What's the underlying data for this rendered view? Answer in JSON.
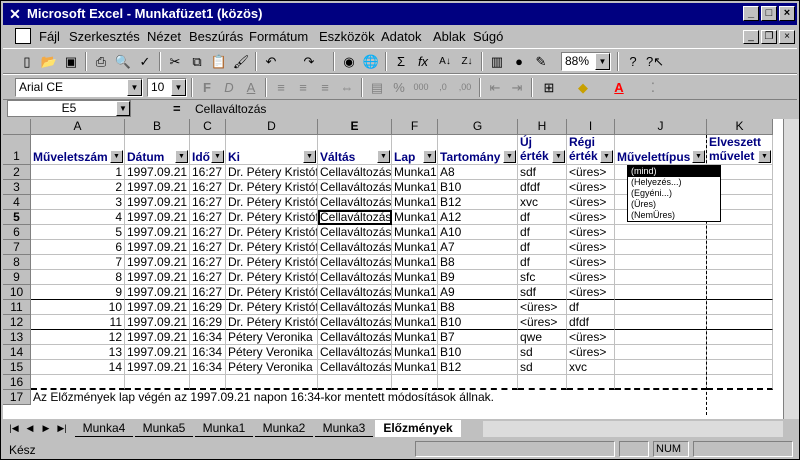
{
  "window": {
    "title": "Microsoft Excel - Munkafüzet1  (közös)",
    "controls": [
      "_",
      "□",
      "×"
    ]
  },
  "menu": [
    "Fájl",
    "Szerkesztés",
    "Nézet",
    "Beszúrás",
    "Formátum",
    "Eszközök",
    "Adatok",
    "Ablak",
    "Súgó"
  ],
  "toolbar": {
    "zoom": "88%",
    "font_name": "Arial CE",
    "font_size": "10",
    "bold": "F",
    "italic": "D",
    "underline": "A",
    "sum": "Σ",
    "fx": "fx",
    "sort_asc": "A↓",
    "sort_desc": "Z↓",
    "percent": "%",
    "thousands": "000",
    "dec_inc": ",0",
    "dec_dec": ",00",
    "font_color": "A",
    "help": "?"
  },
  "formula_bar": {
    "name_box": "E5",
    "equals": "=",
    "value": "Cellaváltozás"
  },
  "columns": [
    "A",
    "B",
    "C",
    "D",
    "E",
    "F",
    "G",
    "H",
    "I",
    "J",
    "K"
  ],
  "header_row": {
    "A": "Műveletszám",
    "B": "Dátum",
    "C": "Idő",
    "D": "Ki",
    "E": "Váltás",
    "F": "Lap",
    "G": "Tartomány",
    "H1": "Új",
    "H2": "érték",
    "I1": "Régi",
    "I2": "érték",
    "J": "Művelettípus",
    "K1": "Elveszett",
    "K2": "művelet"
  },
  "rows": [
    {
      "n": "2",
      "a": "1",
      "b": "1997.09.21",
      "c": "16:27",
      "d": "Dr. Pétery Kristóf",
      "e": "Cellaváltozás",
      "f": "Munka1",
      "g": "A8",
      "h": "sdf",
      "i": "<üres>"
    },
    {
      "n": "3",
      "a": "2",
      "b": "1997.09.21",
      "c": "16:27",
      "d": "Dr. Pétery Kristóf",
      "e": "Cellaváltozás",
      "f": "Munka1",
      "g": "B10",
      "h": "dfdf",
      "i": "<üres>"
    },
    {
      "n": "4",
      "a": "3",
      "b": "1997.09.21",
      "c": "16:27",
      "d": "Dr. Pétery Kristóf",
      "e": "Cellaváltozás",
      "f": "Munka1",
      "g": "B12",
      "h": "xvc",
      "i": "<üres>"
    },
    {
      "n": "5",
      "a": "4",
      "b": "1997.09.21",
      "c": "16:27",
      "d": "Dr. Pétery Kristóf",
      "e": "Cellaváltozás",
      "f": "Munka1",
      "g": "A12",
      "h": "df",
      "i": "<üres>"
    },
    {
      "n": "6",
      "a": "5",
      "b": "1997.09.21",
      "c": "16:27",
      "d": "Dr. Pétery Kristóf",
      "e": "Cellaváltozás",
      "f": "Munka1",
      "g": "A10",
      "h": "df",
      "i": "<üres>"
    },
    {
      "n": "7",
      "a": "6",
      "b": "1997.09.21",
      "c": "16:27",
      "d": "Dr. Pétery Kristóf",
      "e": "Cellaváltozás",
      "f": "Munka1",
      "g": "A7",
      "h": "df",
      "i": "<üres>"
    },
    {
      "n": "8",
      "a": "7",
      "b": "1997.09.21",
      "c": "16:27",
      "d": "Dr. Pétery Kristóf",
      "e": "Cellaváltozás",
      "f": "Munka1",
      "g": "B8",
      "h": "df",
      "i": "<üres>"
    },
    {
      "n": "9",
      "a": "8",
      "b": "1997.09.21",
      "c": "16:27",
      "d": "Dr. Pétery Kristóf",
      "e": "Cellaváltozás",
      "f": "Munka1",
      "g": "B9",
      "h": "sfc",
      "i": "<üres>"
    },
    {
      "n": "10",
      "a": "9",
      "b": "1997.09.21",
      "c": "16:27",
      "d": "Dr. Pétery Kristóf",
      "e": "Cellaváltozás",
      "f": "Munka1",
      "g": "A9",
      "h": "sdf",
      "i": "<üres>"
    },
    {
      "n": "11",
      "a": "10",
      "b": "1997.09.21",
      "c": "16:29",
      "d": "Dr. Pétery Kristóf",
      "e": "Cellaváltozás",
      "f": "Munka1",
      "g": "B8",
      "h": "<üres>",
      "i": "df"
    },
    {
      "n": "12",
      "a": "11",
      "b": "1997.09.21",
      "c": "16:29",
      "d": "Dr. Pétery Kristóf",
      "e": "Cellaváltozás",
      "f": "Munka1",
      "g": "B10",
      "h": "<üres>",
      "i": "dfdf"
    },
    {
      "n": "13",
      "a": "12",
      "b": "1997.09.21",
      "c": "16:34",
      "d": "Pétery Veronika",
      "e": "Cellaváltozás",
      "f": "Munka1",
      "g": "B7",
      "h": "qwe",
      "i": "<üres>"
    },
    {
      "n": "14",
      "a": "13",
      "b": "1997.09.21",
      "c": "16:34",
      "d": "Pétery Veronika",
      "e": "Cellaváltozás",
      "f": "Munka1",
      "g": "B10",
      "h": "sd",
      "i": "<üres>"
    },
    {
      "n": "15",
      "a": "14",
      "b": "1997.09.21",
      "c": "16:34",
      "d": "Pétery Veronika",
      "e": "Cellaváltozás",
      "f": "Munka1",
      "g": "B12",
      "h": "sd",
      "i": "xvc"
    }
  ],
  "row16": "16",
  "row17": {
    "n": "17",
    "text": "Az Előzmények lap végén az 1997.09.21 napon 16:34-kor mentett módosítások állnak."
  },
  "row1_label": "1",
  "filter_dropdown": [
    "(mind)",
    "(Helyezés...)",
    "(Egyéni...)",
    "(Üres)",
    "(NemÜres)"
  ],
  "sheet_tabs": [
    "Munka4",
    "Munka5",
    "Munka1",
    "Munka2",
    "Munka3",
    "Előzmények"
  ],
  "active_sheet": "Előzmények",
  "status": {
    "ready": "Kész",
    "num": "NUM"
  }
}
